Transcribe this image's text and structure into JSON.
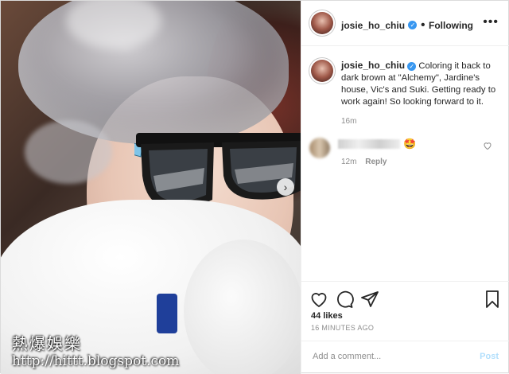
{
  "post": {
    "username": "josie_ho_chiu",
    "follow_status": "Following",
    "separator": "•",
    "more_icon": "more-horizontal-icon",
    "verified_icon": "verified-badge-icon",
    "caption_text": "Coloring it back to dark brown at \"Alchemy\", Jardine's house, Vic's and Suki. Getting ready to work again! So looking forward to it.",
    "caption_time": "16m",
    "comment_emoji": "🤩",
    "comment_time": "12m",
    "reply_label": "Reply",
    "likes": "44 likes",
    "posted_time": "16 MINUTES AGO",
    "comment_placeholder": "Add a comment...",
    "post_label": "Post",
    "next_arrow": "›"
  },
  "watermark": {
    "title": "熱爆娛樂",
    "url": "http://hittt.blogspot.com"
  },
  "colors": {
    "accent": "#3897f0",
    "post_disabled": "#b2dffc",
    "text": "#262626",
    "secondary": "#8e8e8e"
  }
}
